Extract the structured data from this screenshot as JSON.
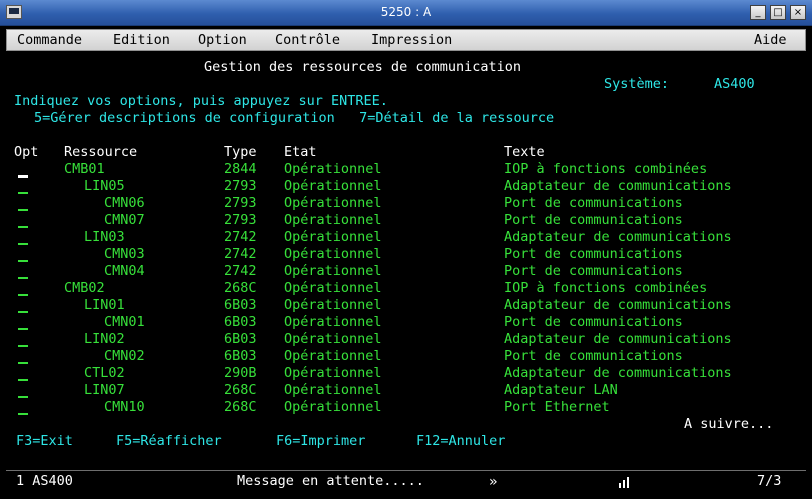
{
  "window": {
    "title": "5250 : A",
    "min": "_",
    "max": "□",
    "close": "×"
  },
  "menu": {
    "items": [
      "Commande",
      "Edition",
      "Option",
      "Contrôle",
      "Impression"
    ],
    "help": "Aide"
  },
  "screen": {
    "title": "Gestion des ressources de communication",
    "system_label": "Système:",
    "system_value": "AS400",
    "instructions": "Indiquez vos options, puis appuyez sur ENTREE.",
    "options": "5=Gérer descriptions de configuration   7=Détail de la ressource",
    "headers": {
      "opt": "Opt",
      "resource": "Ressource",
      "type": "Type",
      "state": "Etat",
      "text": "Texte"
    },
    "rows": [
      {
        "resource": "CMB01",
        "type": "2844",
        "state": "Opérationnel",
        "text": "IOP à fonctions combinées"
      },
      {
        "resource": "LIN05",
        "type": "2793",
        "state": "Opérationnel",
        "text": "Adaptateur de communications"
      },
      {
        "resource": "CMN06",
        "type": "2793",
        "state": "Opérationnel",
        "text": "Port de communications"
      },
      {
        "resource": "CMN07",
        "type": "2793",
        "state": "Opérationnel",
        "text": "Port de communications"
      },
      {
        "resource": "LIN03",
        "type": "2742",
        "state": "Opérationnel",
        "text": "Adaptateur de communications"
      },
      {
        "resource": "CMN03",
        "type": "2742",
        "state": "Opérationnel",
        "text": "Port de communications"
      },
      {
        "resource": "CMN04",
        "type": "2742",
        "state": "Opérationnel",
        "text": "Port de communications"
      },
      {
        "resource": "CMB02",
        "type": "268C",
        "state": "Opérationnel",
        "text": "IOP à fonctions combinées"
      },
      {
        "resource": "LIN01",
        "type": "6B03",
        "state": "Opérationnel",
        "text": "Adaptateur de communications"
      },
      {
        "resource": "CMN01",
        "type": "6B03",
        "state": "Opérationnel",
        "text": "Port de communications"
      },
      {
        "resource": "LIN02",
        "type": "6B03",
        "state": "Opérationnel",
        "text": "Adaptateur de communications"
      },
      {
        "resource": "CMN02",
        "type": "6B03",
        "state": "Opérationnel",
        "text": "Port de communications"
      },
      {
        "resource": "CTL02",
        "type": "290B",
        "state": "Opérationnel",
        "text": "Adaptateur de communications"
      },
      {
        "resource": "LIN07",
        "type": "268C",
        "state": "Opérationnel",
        "text": "Adaptateur LAN"
      },
      {
        "resource": "CMN10",
        "type": "268C",
        "state": "Opérationnel",
        "text": "Port Ethernet"
      }
    ],
    "more": "A suivre...",
    "function_keys": [
      "F3=Exit",
      "F5=Réafficher",
      "F6=Imprimer",
      "F12=Annuler"
    ]
  },
  "status": {
    "session": "1 AS400",
    "message": "Message en attente.....",
    "arrows": "»",
    "page": "7/3"
  }
}
